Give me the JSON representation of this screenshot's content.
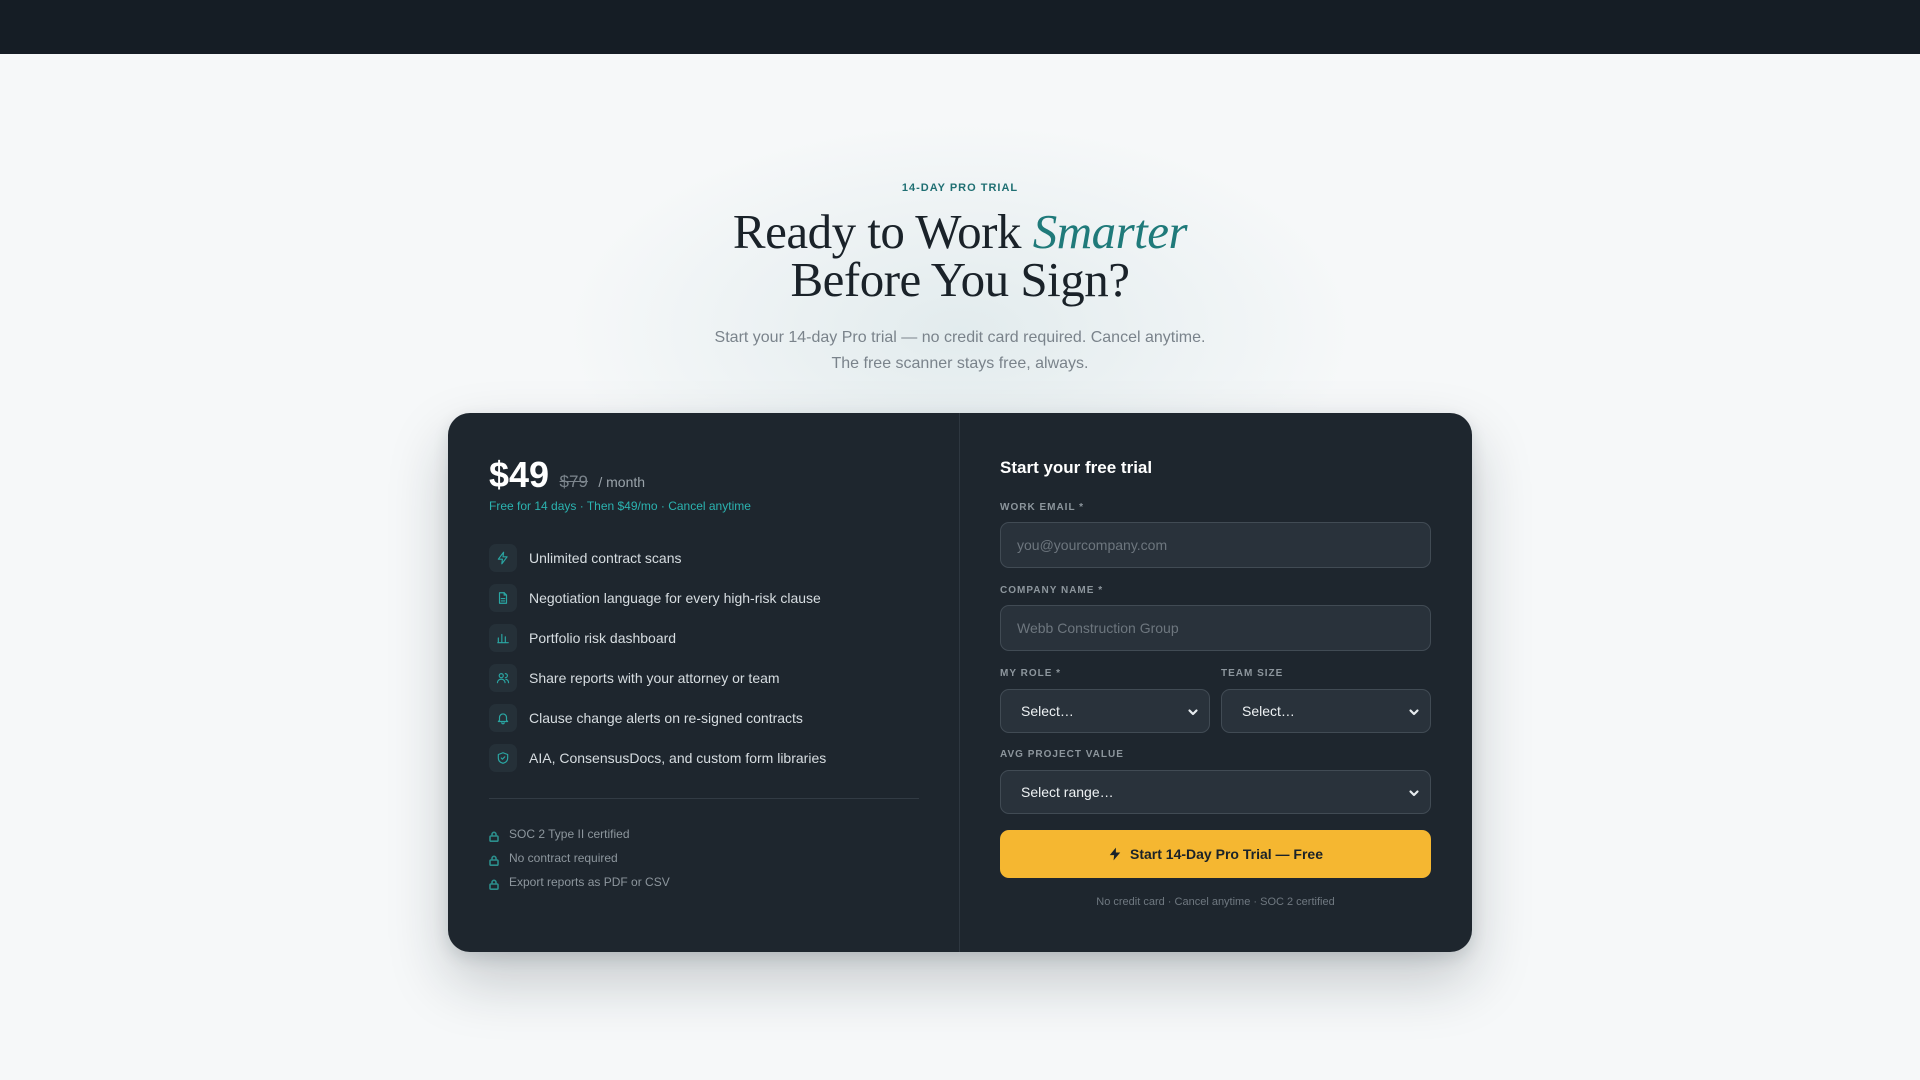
{
  "hero": {
    "eyebrow": "14-DAY PRO TRIAL",
    "headline_part1": "Ready to Work ",
    "headline_accent": "Smarter",
    "headline_part2": "Before You Sign?",
    "sub_line1": "Start your 14-day Pro trial — no credit card required. Cancel anytime.",
    "sub_line2": "The free scanner stays free, always."
  },
  "plan": {
    "price": "$49",
    "old_price": "$79",
    "period": "/ month",
    "trial_note": "Free for 14 days · Then $49/mo · Cancel anytime",
    "features": [
      {
        "icon": "lightning-icon",
        "label": "Unlimited contract scans"
      },
      {
        "icon": "document-icon",
        "label": "Negotiation language for every high-risk clause"
      },
      {
        "icon": "bar-chart-icon",
        "label": "Portfolio risk dashboard"
      },
      {
        "icon": "users-icon",
        "label": "Share reports with your attorney or team"
      },
      {
        "icon": "bell-icon",
        "label": "Clause change alerts on re-signed contracts"
      },
      {
        "icon": "shield-icon",
        "label": "AIA, ConsensusDocs, and custom form libraries"
      }
    ],
    "trust": [
      "SOC 2 Type II certified",
      "No contract required",
      "Export reports as PDF or CSV"
    ]
  },
  "form": {
    "title": "Start your free trial",
    "email_label": "WORK EMAIL *",
    "email_placeholder": "you@yourcompany.com",
    "company_label": "COMPANY NAME *",
    "company_placeholder": "Webb Construction Group",
    "role_label": "MY ROLE *",
    "role_value": "Select…",
    "team_label": "TEAM SIZE",
    "team_value": "Select…",
    "project_label": "AVG PROJECT VALUE",
    "project_value": "Select range…",
    "cta_label": "Start 14-Day Pro Trial — Free",
    "footnote": "No credit card · Cancel anytime · SOC 2 certified"
  },
  "colors": {
    "accent": "#1f7a7a",
    "cta": "#f5b731",
    "card": "#1e262e"
  }
}
